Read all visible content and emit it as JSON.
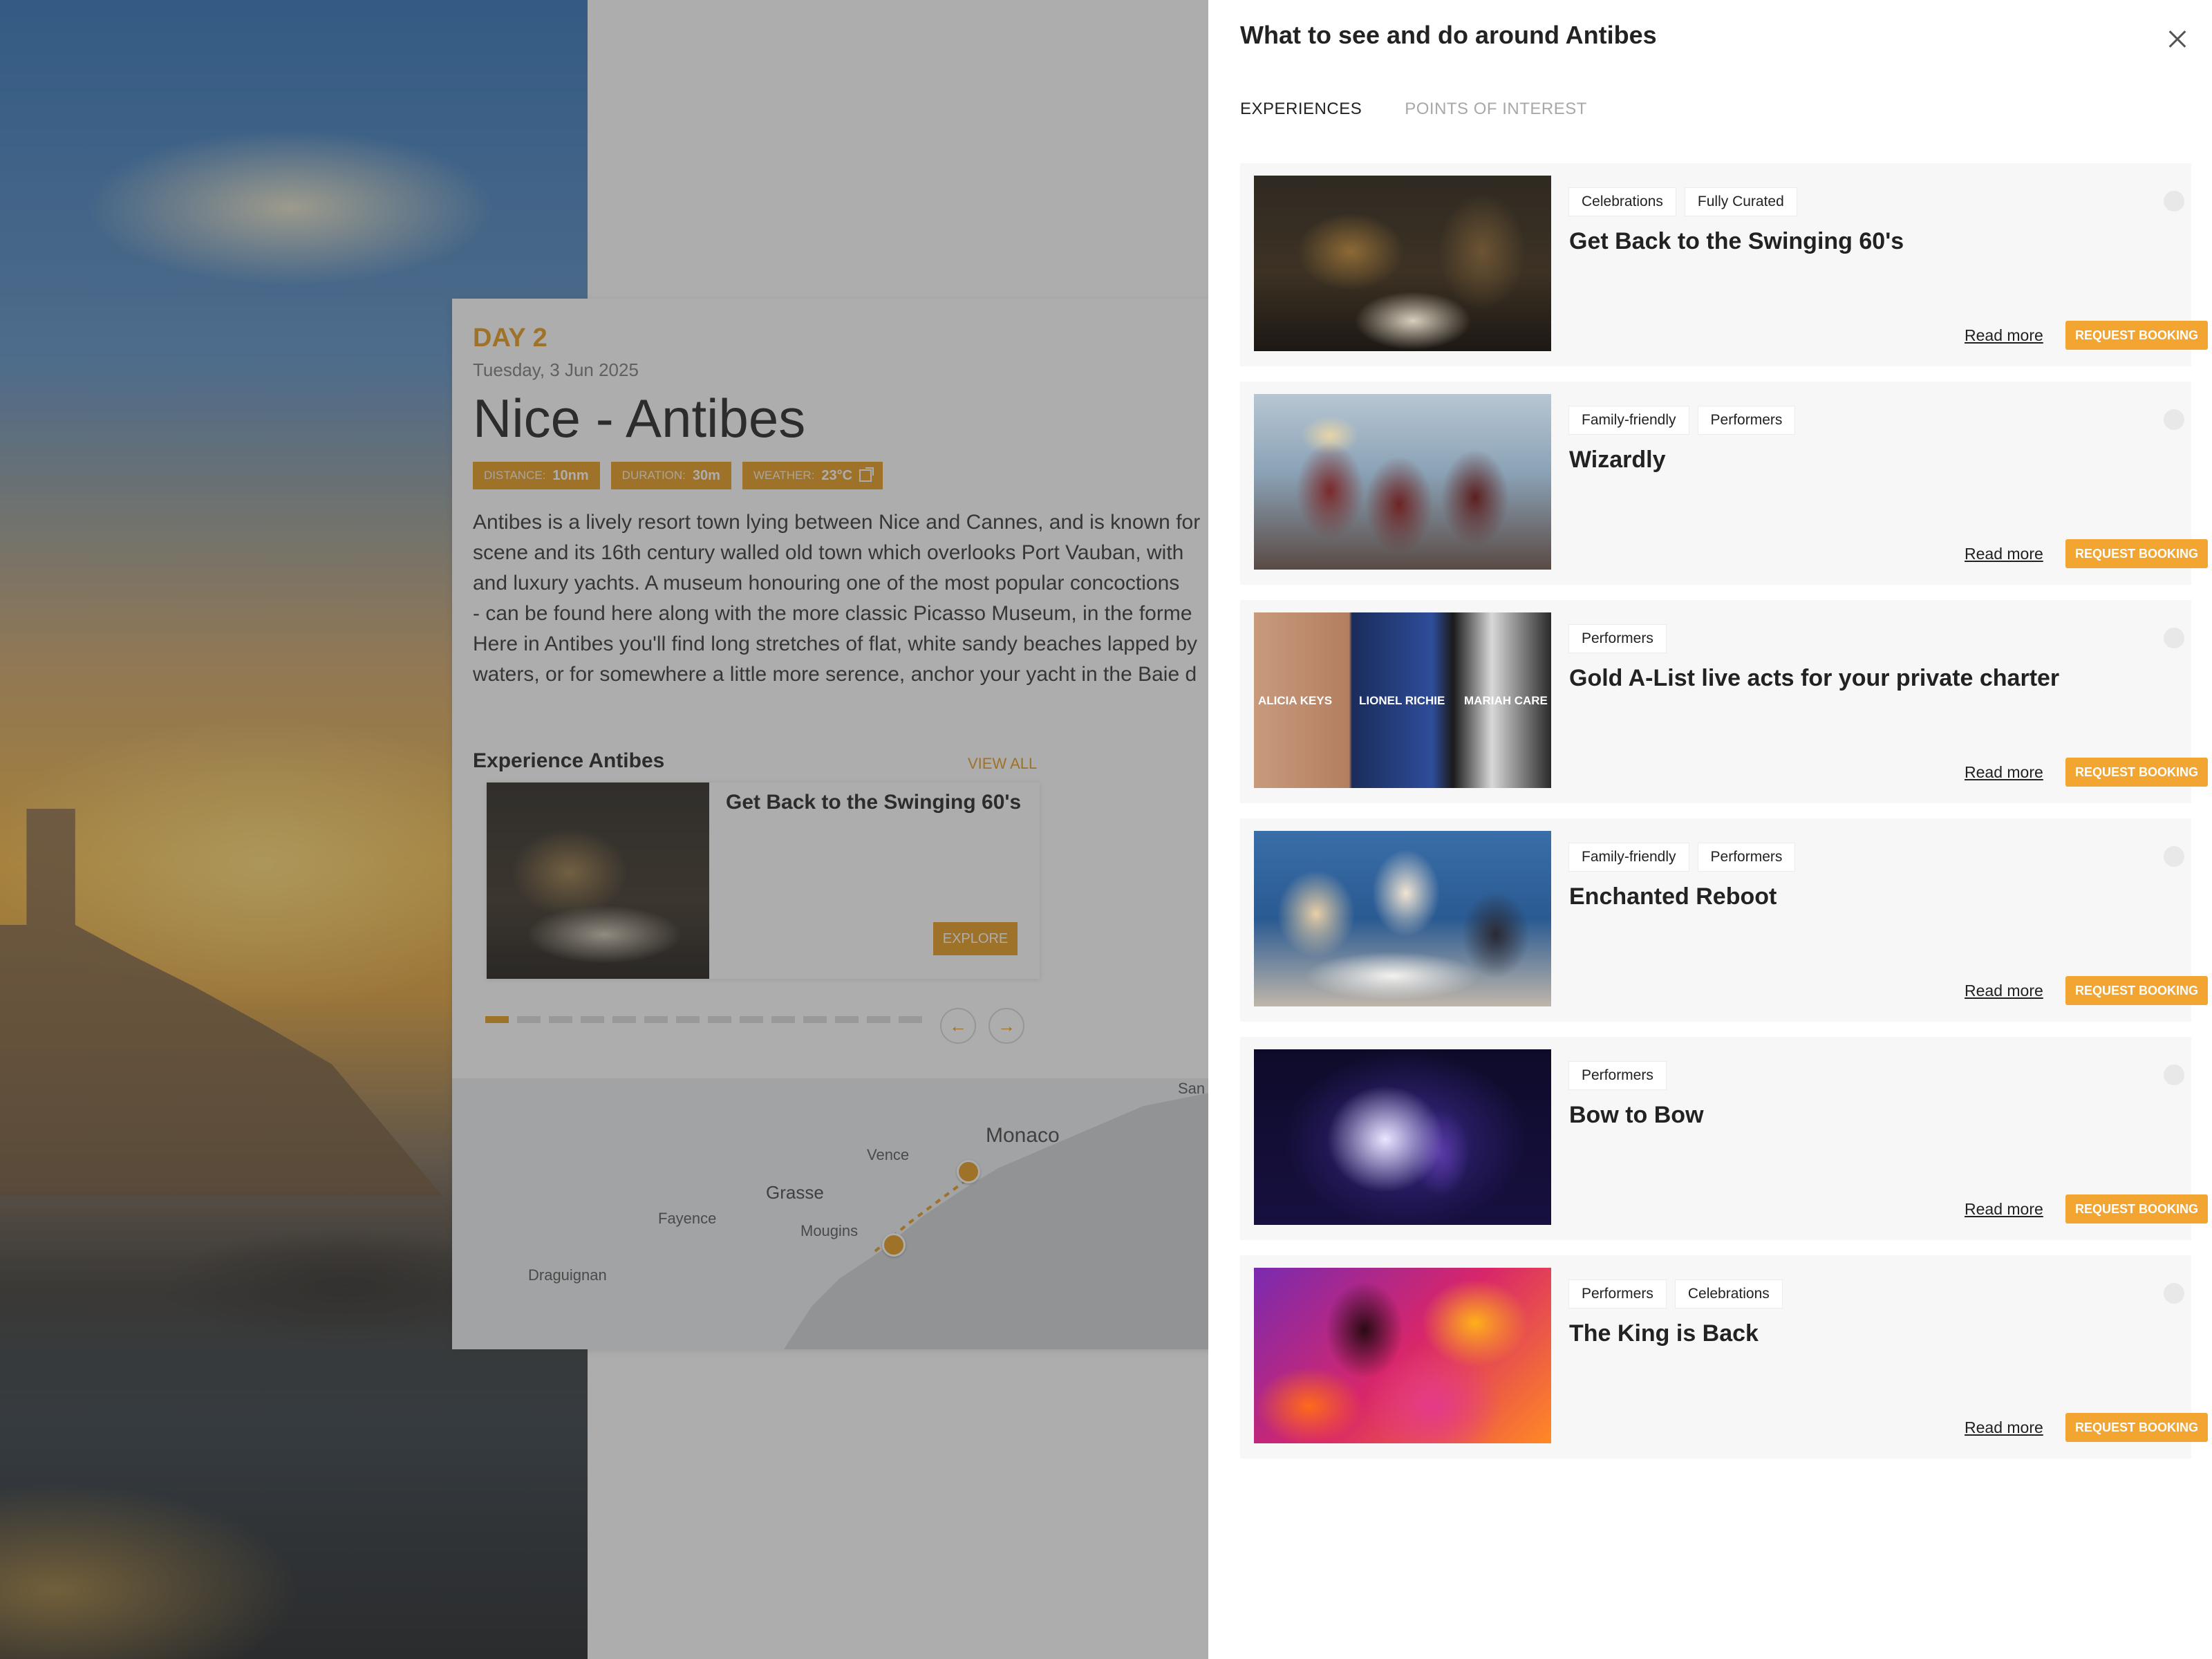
{
  "itinerary": {
    "day_label": "DAY 2",
    "date": "Tuesday, 3 Jun 2025",
    "title": "Nice - Antibes",
    "stats": [
      {
        "key": "DISTANCE:",
        "value": "10nm"
      },
      {
        "key": "DURATION:",
        "value": "30m"
      },
      {
        "key": "WEATHER:",
        "value": "23°C"
      }
    ],
    "description": "Antibes is a lively resort town lying between Nice and Cannes, and is known for\nscene and its 16th century walled old town which overlooks Port Vauban, with\nand luxury yachts. A museum honouring one of the most popular concoctions\n- can be found here along with the more classic Picasso Museum, in the forme\nHere in Antibes you'll find long stretches of flat, white sandy beaches lapped by\nwaters, or for somewhere a little more serence, anchor your yacht in the Baie d\nwith its rocky coastline, it is the perfect spot to snorkel in the crystal clear wate",
    "experience_heading": "Experience Antibes",
    "view_all": "VIEW ALL",
    "featured_experience": "Get Back to the Swinging 60's",
    "explore": "EXPLORE",
    "pager_total": 14,
    "pager_active": 0,
    "prev_icon": "arrow-left-icon",
    "next_icon": "arrow-right-icon",
    "map_labels": [
      "Monaco",
      "Vence",
      "Grasse",
      "Fayence",
      "Mougins",
      "Draguignan",
      "San"
    ]
  },
  "drawer": {
    "title": "What to see and do around Antibes",
    "close_icon": "close-icon",
    "tabs": [
      {
        "label": "EXPERIENCES",
        "active": true
      },
      {
        "label": "POINTS OF INTEREST",
        "active": false
      }
    ],
    "read_more": "Read more",
    "request_booking": "REQUEST BOOKING",
    "items": [
      {
        "title": "Get Back to the Swinging 60's",
        "tags": [
          "Celebrations",
          "Fully Curated"
        ]
      },
      {
        "title": "Wizardly",
        "tags": [
          "Family-friendly",
          "Performers"
        ]
      },
      {
        "title": "Gold A-List live acts for your private charter",
        "tags": [
          "Performers"
        ],
        "image_captions": [
          "ALICIA KEYS",
          "LIONEL RICHIE",
          "MARIAH CARE"
        ]
      },
      {
        "title": "Enchanted Reboot",
        "tags": [
          "Family-friendly",
          "Performers"
        ]
      },
      {
        "title": "Bow to Bow",
        "tags": [
          "Performers"
        ]
      },
      {
        "title": "The King is Back",
        "tags": [
          "Performers",
          "Celebrations"
        ]
      }
    ]
  },
  "colors": {
    "accent": "#e59a1c",
    "button": "#f2a531"
  }
}
